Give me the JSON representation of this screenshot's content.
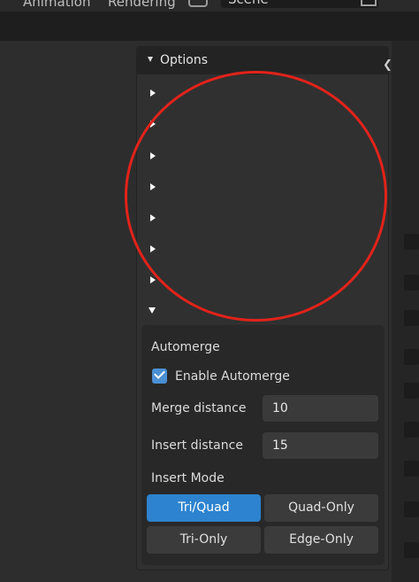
{
  "top_menu": {
    "items": [
      "Animation",
      "Rendering"
    ],
    "scene_name": "Scene"
  },
  "options_panel": {
    "title": "Options",
    "collapsed_rows": 7
  },
  "automerge": {
    "heading": "Automerge",
    "enable_label": "Enable Automerge",
    "enabled": true,
    "merge_distance_label": "Merge distance",
    "merge_distance_value": "10",
    "insert_distance_label": "Insert distance",
    "insert_distance_value": "15",
    "insert_mode_label": "Insert Mode",
    "modes": [
      "Tri/Quad",
      "Quad-Only",
      "Tri-Only",
      "Edge-Only"
    ],
    "selected_mode": "Tri/Quad"
  },
  "colors": {
    "accent": "#2d83cf",
    "checkbox": "#4a8fd4",
    "annotation": "#e2231a",
    "panel_bg": "#303030",
    "section_bg": "#282828"
  }
}
